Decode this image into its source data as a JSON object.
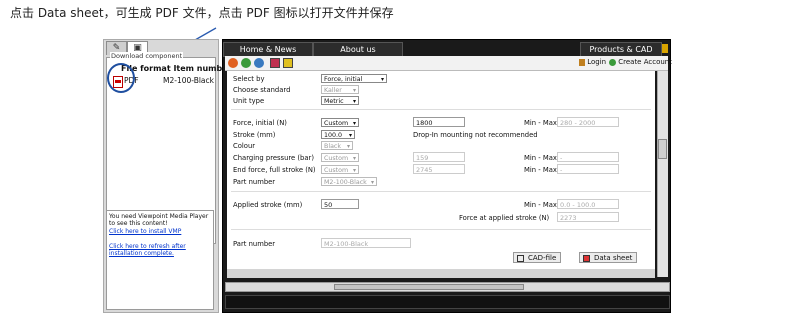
{
  "caption": "点击 Data sheet，可生成 PDF 文件，点击 PDF 图标以打开文件并保存",
  "left_panel": {
    "tabs": [
      "",
      ""
    ],
    "download_legend": "Download component",
    "columns": {
      "file_format": "File format",
      "item_number": "Item number"
    },
    "rows": [
      {
        "type": "PDF",
        "item": "M2-100-Black"
      }
    ],
    "vmp_notice": "You need Viewpoint Media Player to see this content!",
    "install_link": "Click here to install VMP",
    "refresh_link": "Click here to refresh after installation complete."
  },
  "nav": {
    "home": "Home & News",
    "about": "About us",
    "products": "Products & CAD"
  },
  "toolbar": {
    "login": "Login",
    "create_account": "Create Account"
  },
  "form": {
    "select_by": {
      "label": "Select by",
      "value": "Force, initial"
    },
    "choose_standard": {
      "label": "Choose standard",
      "value": "Kaller"
    },
    "unit_type": {
      "label": "Unit type",
      "value": "Metric"
    },
    "force_initial": {
      "label": "Force, initial (N)",
      "mode": "Custom",
      "value": "1800",
      "minmax_label": "Min - Max",
      "minmax": "280 - 2000"
    },
    "stroke": {
      "label": "Stroke (mm)",
      "value": "100.0",
      "note": "Drop-In mounting not recommended"
    },
    "colour": {
      "label": "Colour",
      "value": "Black"
    },
    "charging_pressure": {
      "label": "Charging pressure (bar)",
      "mode": "Custom",
      "value": "159",
      "minmax_label": "Min - Max",
      "minmax": "-"
    },
    "end_force": {
      "label": "End force, full stroke (N)",
      "mode": "Custom",
      "value": "2745",
      "minmax_label": "Min - Max",
      "minmax": "-"
    },
    "part_number_sel": {
      "label": "Part number",
      "value": "M2-100-Black"
    },
    "applied_stroke": {
      "label": "Applied stroke (mm)",
      "value": "50",
      "minmax_label": "Min - Max",
      "minmax": "0.0 - 100.0"
    },
    "force_at_applied": {
      "label": "Force at applied stroke (N)",
      "value": "2273"
    },
    "part_number": {
      "label": "Part number",
      "value": "M2-100-Black"
    }
  },
  "buttons": {
    "cad_file": "CAD-file",
    "data_sheet": "Data sheet"
  },
  "colors": {
    "accent_circle": "#1f4fa0",
    "app_bg": "#1a1a1a"
  }
}
